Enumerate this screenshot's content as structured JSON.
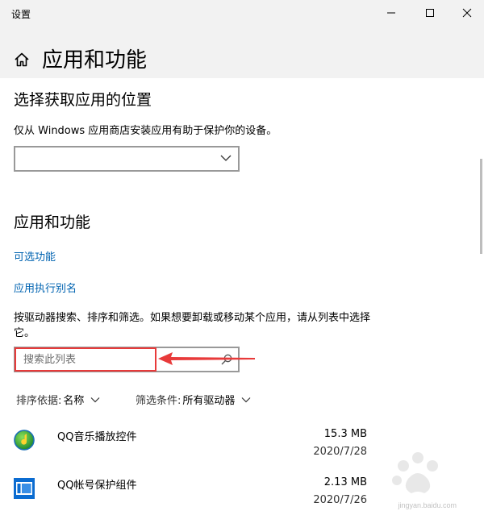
{
  "window": {
    "title": "设置"
  },
  "page": {
    "title": "应用和功能"
  },
  "location_section": {
    "heading": "选择获取应用的位置",
    "description": "仅从 Windows 应用商店安装应用有助于保护你的设备。",
    "dropdown_value": ""
  },
  "apps_section": {
    "heading": "应用和功能",
    "links": {
      "optional_features": "可选功能",
      "app_execution_alias": "应用执行别名"
    },
    "search_description": "按驱动器搜索、排序和筛选。如果想要卸载或移动某个应用，请从列表中选择它。",
    "search": {
      "placeholder": "搜索此列表",
      "value": ""
    },
    "sort": {
      "label": "排序依据:",
      "value": "名称"
    },
    "filter": {
      "label": "筛选条件:",
      "value": "所有驱动器"
    },
    "apps": [
      {
        "name": "QQ音乐播放控件",
        "size": "15.3 MB",
        "date": "2020/7/28",
        "icon": "qq-music-icon"
      },
      {
        "name": "QQ帐号保护组件",
        "size": "2.13 MB",
        "date": "2020/7/26",
        "icon": "qq-account-protect-icon"
      }
    ]
  },
  "icons": {
    "home": "home-icon",
    "minimize": "minimize-icon",
    "maximize": "maximize-icon",
    "close": "close-icon",
    "dropdown": "chevron-down-icon",
    "search": "search-icon"
  },
  "colors": {
    "accent_link": "#0063b1",
    "header_bg": "#f2f2f2",
    "annotation_red": "#e83a3a"
  },
  "watermark": {
    "text": "jingyan.baidu.com"
  }
}
